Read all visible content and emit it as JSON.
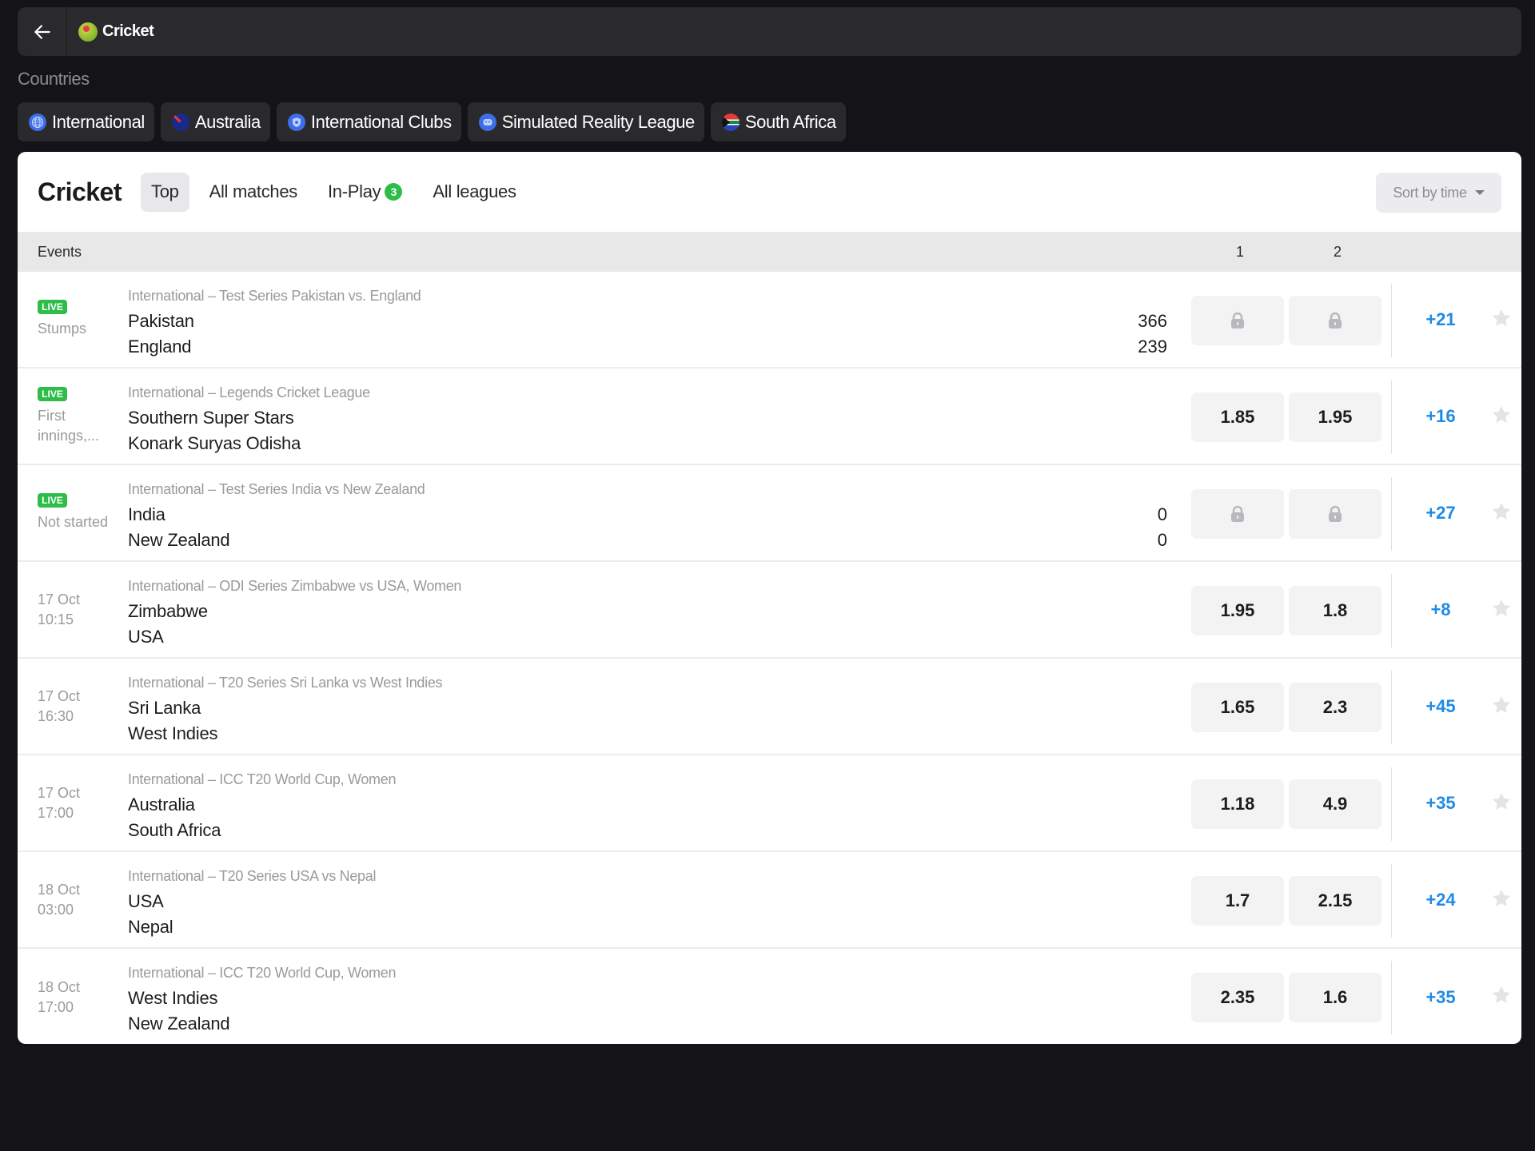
{
  "topbar": {
    "title": "Cricket",
    "back_icon": "arrow-left-icon",
    "sport_icon": "cricket-icon"
  },
  "countries": {
    "label": "Countries",
    "chips": [
      {
        "label": "International",
        "icon": "globe-icon"
      },
      {
        "label": "Australia",
        "icon": "australia-flag-icon"
      },
      {
        "label": "International Clubs",
        "icon": "shield-icon"
      },
      {
        "label": "Simulated Reality League",
        "icon": "gamepad-icon"
      },
      {
        "label": "South Africa",
        "icon": "south-africa-flag-icon"
      }
    ]
  },
  "card": {
    "title": "Cricket",
    "tabs": [
      {
        "label": "Top",
        "active": true
      },
      {
        "label": "All matches"
      },
      {
        "label": "In-Play",
        "badge": "3"
      },
      {
        "label": "All leagues"
      }
    ],
    "sort": {
      "label": "Sort by time"
    }
  },
  "table": {
    "headers": {
      "events": "Events",
      "col1": "1",
      "col2": "2"
    },
    "rows": [
      {
        "live": "LIVE",
        "status": "Stumps",
        "league": "International – Test Series Pakistan vs. England",
        "team1": "Pakistan",
        "team2": "England",
        "score1": "366",
        "score2": "239",
        "odd1": null,
        "odd2": null,
        "locked": true,
        "more": "+21"
      },
      {
        "live": "LIVE",
        "status": "First innings,...",
        "league": "International – Legends Cricket League",
        "team1": "Southern Super Stars",
        "team2": "Konark Suryas Odisha",
        "score1": "",
        "score2": "",
        "odd1": "1.85",
        "odd2": "1.95",
        "locked": false,
        "more": "+16"
      },
      {
        "live": "LIVE",
        "status": "Not started",
        "league": "International – Test Series India vs New Zealand",
        "team1": "India",
        "team2": "New Zealand",
        "score1": "0",
        "score2": "0",
        "odd1": null,
        "odd2": null,
        "locked": true,
        "more": "+27"
      },
      {
        "live": "",
        "status": "17 Oct 10:15",
        "league": "International – ODI Series Zimbabwe vs USA, Women",
        "team1": "Zimbabwe",
        "team2": "USA",
        "score1": "",
        "score2": "",
        "odd1": "1.95",
        "odd2": "1.8",
        "locked": false,
        "more": "+8"
      },
      {
        "live": "",
        "status": "17 Oct 16:30",
        "league": "International – T20 Series Sri Lanka vs West Indies",
        "team1": "Sri Lanka",
        "team2": "West Indies",
        "score1": "",
        "score2": "",
        "odd1": "1.65",
        "odd2": "2.3",
        "locked": false,
        "more": "+45"
      },
      {
        "live": "",
        "status": "17 Oct 17:00",
        "league": "International – ICC T20 World Cup, Women",
        "team1": "Australia",
        "team2": "South Africa",
        "score1": "",
        "score2": "",
        "odd1": "1.18",
        "odd2": "4.9",
        "locked": false,
        "more": "+35"
      },
      {
        "live": "",
        "status": "18 Oct 03:00",
        "league": "International – T20 Series USA vs Nepal",
        "team1": "USA",
        "team2": "Nepal",
        "score1": "",
        "score2": "",
        "odd1": "1.7",
        "odd2": "2.15",
        "locked": false,
        "more": "+24"
      },
      {
        "live": "",
        "status": "18 Oct 17:00",
        "league": "International – ICC T20 World Cup, Women",
        "team1": "West Indies",
        "team2": "New Zealand",
        "score1": "",
        "score2": "",
        "odd1": "2.35",
        "odd2": "1.6",
        "locked": false,
        "more": "+35"
      }
    ]
  },
  "colors": {
    "accent": "#1e8be6",
    "live": "#2fbd4a",
    "background": "#141318",
    "panel": "#2a292e"
  }
}
